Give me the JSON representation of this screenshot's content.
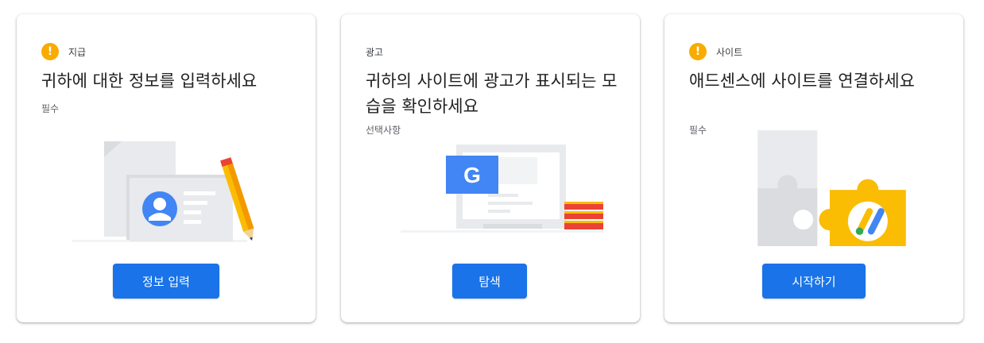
{
  "cards": [
    {
      "eyebrow": "지급",
      "title": "귀하에 대한 정보를 입력하세요",
      "requirement": "필수",
      "button": "정보 입력"
    },
    {
      "eyebrow": "광고",
      "title": "귀하의 사이트에 광고가 표시되는 모습을 확인하세요",
      "requirement": "선택사항",
      "button": "탐색",
      "illustration_letter": "G"
    },
    {
      "eyebrow": "사이트",
      "title": "애드센스에 사이트를 연결하세요",
      "requirement": "필수",
      "button": "시작하기"
    }
  ],
  "warning_glyph": "!",
  "colors": {
    "primary": "#1a73e8",
    "warning": "#f9ab00"
  }
}
